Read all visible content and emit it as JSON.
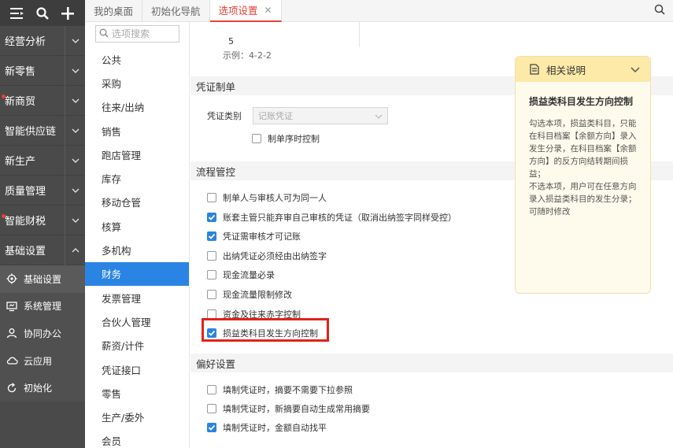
{
  "nav": {
    "top_icons": [
      "menu-icon",
      "search-icon",
      "plus-icon"
    ],
    "items": [
      {
        "label": "经营分析",
        "dot": false,
        "chevron": "down"
      },
      {
        "label": "新零售",
        "dot": false,
        "chevron": "down"
      },
      {
        "label": "新商贸",
        "dot": true,
        "chevron": "down"
      },
      {
        "label": "智能供应链",
        "dot": false,
        "chevron": "down"
      },
      {
        "label": "新生产",
        "dot": false,
        "chevron": "down"
      },
      {
        "label": "质量管理",
        "dot": false,
        "chevron": "down"
      },
      {
        "label": "智能财税",
        "dot": true,
        "chevron": "down"
      },
      {
        "label": "基础设置",
        "dot": false,
        "chevron": "up"
      }
    ],
    "sub_items": [
      {
        "label": "基础设置",
        "icon": "gear-icon"
      },
      {
        "label": "系统管理",
        "icon": "monitor-icon"
      },
      {
        "label": "协同办公",
        "icon": "person-icon"
      },
      {
        "label": "云应用",
        "icon": "cloud-icon"
      },
      {
        "label": "初始化",
        "icon": "refresh-icon"
      }
    ]
  },
  "tabs": [
    {
      "label": "我的桌面"
    },
    {
      "label": "初始化导航"
    },
    {
      "label": "选项设置",
      "active": true,
      "close": "✕"
    }
  ],
  "categories": {
    "search_placeholder": "选项搜索",
    "items": [
      "公共",
      "采购",
      "往来/出纳",
      "销售",
      "跑店管理",
      "库存",
      "移动仓管",
      "核算",
      "多机构",
      "财务",
      "发票管理",
      "合伙人管理",
      "薪资/计件",
      "凭证接口",
      "零售",
      "生产/委外",
      "会员"
    ],
    "active": "财务"
  },
  "main": {
    "sample_value": "5",
    "sample_example": "示例：4-2-2",
    "voucher_section": {
      "title": "凭证制单",
      "type_label": "凭证类别",
      "type_value": "记账凭证",
      "sequence_label": "制单序时控制",
      "sequence_checked": false
    },
    "flow_section": {
      "title": "流程管控",
      "options": [
        {
          "label": "制单人与审核人可为同一人",
          "checked": false
        },
        {
          "label": "账套主管只能弃审自己审核的凭证（取消出纳签字同样受控）",
          "checked": true
        },
        {
          "label": "凭证需审核才可记账",
          "checked": true
        },
        {
          "label": "出纳凭证必须经由出纳签字",
          "checked": false
        },
        {
          "label": "现金流量必录",
          "checked": false
        },
        {
          "label": "现金流量限制修改",
          "checked": false
        },
        {
          "label": "资金及往来赤字控制",
          "checked": false
        },
        {
          "label": "损益类科目发生方向控制",
          "checked": true
        }
      ]
    },
    "pref_section": {
      "title": "偏好设置",
      "options": [
        {
          "label": "填制凭证时，摘要不需要下拉参照",
          "checked": false
        },
        {
          "label": "填制凭证时，新摘要自动生成常用摘要",
          "checked": false
        },
        {
          "label": "填制凭证时，金额自动找平",
          "checked": true
        }
      ]
    }
  },
  "help": {
    "header": "相关说明",
    "title": "损益类科目发生方向控制",
    "body": "勾选本项，损益类科目，只能在科目档案【余额方向】录入发生分录，在科目档案【余额方向】的反方向结转期间损益；\n不选本项，用户可在任意方向录入损益类科目的发生分录；可随时修改"
  },
  "colors": {
    "nav_bg": "#4a4a4a",
    "accent_blue": "#2a84e4",
    "accent_red": "#e8403a",
    "help_header_bg": "#fde9a8"
  }
}
